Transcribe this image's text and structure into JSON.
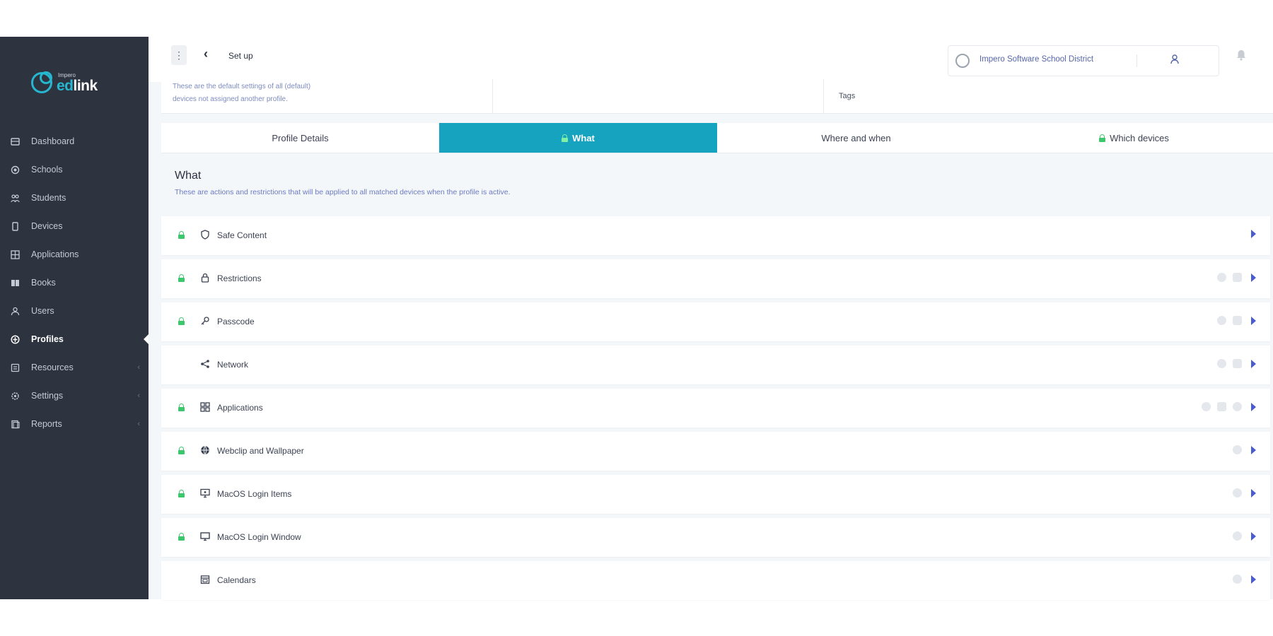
{
  "brand": {
    "small": "Impero",
    "name_a": "ed",
    "name_b": "link"
  },
  "sidebar": {
    "items": [
      {
        "label": "Dashboard",
        "icon": "dashboard-icon",
        "active": false,
        "chevron": false
      },
      {
        "label": "Schools",
        "icon": "school-icon",
        "active": false,
        "chevron": false
      },
      {
        "label": "Students",
        "icon": "students-icon",
        "active": false,
        "chevron": false
      },
      {
        "label": "Devices",
        "icon": "device-icon",
        "active": false,
        "chevron": false
      },
      {
        "label": "Applications",
        "icon": "applications-icon",
        "active": false,
        "chevron": false
      },
      {
        "label": "Books",
        "icon": "book-icon",
        "active": false,
        "chevron": false
      },
      {
        "label": "Users",
        "icon": "users-icon",
        "active": false,
        "chevron": false
      },
      {
        "label": "Profiles",
        "icon": "profile-icon",
        "active": true,
        "chevron": false
      },
      {
        "label": "Resources",
        "icon": "resources-icon",
        "active": false,
        "chevron": true
      },
      {
        "label": "Settings",
        "icon": "settings-icon",
        "active": false,
        "chevron": true
      },
      {
        "label": "Reports",
        "icon": "reports-icon",
        "active": false,
        "chevron": true
      }
    ]
  },
  "topbar": {
    "kebab": "⋮",
    "back": "‹",
    "breadcrumb": "Set up",
    "district": "Impero Software School District",
    "bell": "🔔"
  },
  "info": {
    "line1": "These are the default settings of all",
    "line1b": "(default)",
    "line2": "devices not assigned another profile.",
    "tags": "Tags"
  },
  "tabs": [
    {
      "label": "Profile Details",
      "lock": false,
      "active": false
    },
    {
      "label": "What",
      "lock": true,
      "active": true
    },
    {
      "label": "Where and when",
      "lock": false,
      "active": false
    },
    {
      "label": "Which devices",
      "lock": true,
      "active": false
    }
  ],
  "section": {
    "title": "What",
    "subtitle": "These are actions and restrictions that will be applied to all matched devices when the profile is active."
  },
  "rows": [
    {
      "label": "Safe Content",
      "icon": "shield-icon",
      "glyph": "⛉",
      "lock": true,
      "dots": 0
    },
    {
      "label": "Restrictions",
      "icon": "lock-icon",
      "glyph": "🔒",
      "lock": true,
      "dots": 2
    },
    {
      "label": "Passcode",
      "icon": "key-icon",
      "glyph": "⚷",
      "lock": true,
      "dots": 2
    },
    {
      "label": "Network",
      "icon": "network-icon",
      "glyph": "⋖",
      "lock": false,
      "dots": 2
    },
    {
      "label": "Applications",
      "icon": "apps-grid-icon",
      "glyph": "▦",
      "lock": true,
      "dots": 3
    },
    {
      "label": "Webclip and Wallpaper",
      "icon": "globe-icon",
      "glyph": "◍",
      "lock": true,
      "dots": 1
    },
    {
      "label": "MacOS Login Items",
      "icon": "monitor-icon",
      "glyph": "▣",
      "lock": true,
      "dots": 1
    },
    {
      "label": "MacOS Login Window",
      "icon": "desktop-icon",
      "glyph": "▭",
      "lock": true,
      "dots": 1
    },
    {
      "label": "Calendars",
      "icon": "calendar-icon",
      "glyph": "▤",
      "lock": false,
      "dots": 1
    }
  ],
  "colors": {
    "sidebar": "#2d3440",
    "accent": "#15a3bf",
    "lock": "#3bc76b",
    "caret": "#4b5bd0"
  }
}
